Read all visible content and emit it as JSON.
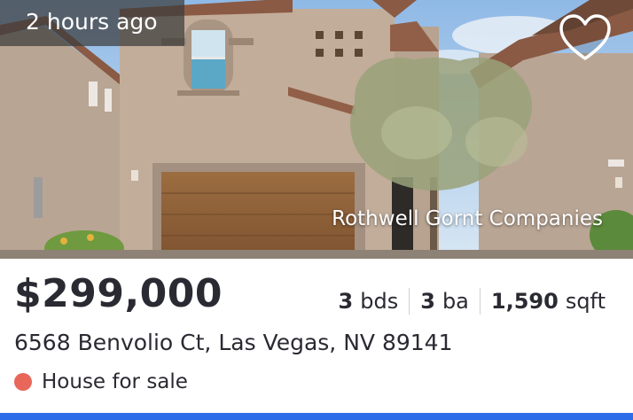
{
  "listing": {
    "time_badge": "2 hours ago",
    "brokerage": "Rothwell Gornt Companies",
    "price": "$299,000",
    "beds": {
      "value": "3",
      "unit": "bds"
    },
    "baths": {
      "value": "3",
      "unit": "ba"
    },
    "area": {
      "value": "1,590",
      "unit": "sqft"
    },
    "address": "6568 Benvolio Ct, Las Vegas, NV 89141",
    "status": "House for sale",
    "favorite_icon": "heart-outline-icon"
  },
  "colors": {
    "status_dot": "#e8675a",
    "bottom_bar": "#2d6ee8",
    "text": "#2a2a33"
  }
}
